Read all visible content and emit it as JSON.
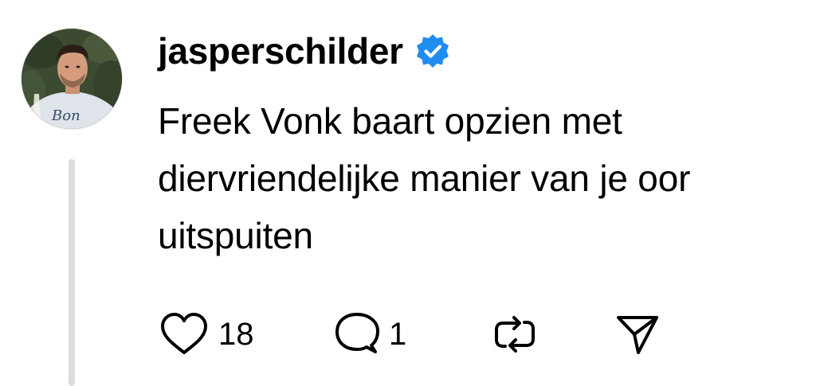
{
  "post": {
    "author": {
      "username": "jasperschilder",
      "verified": true,
      "avatar_text": "Bon"
    },
    "text": "Freek Vonk baart opzien met diervriendelijke manier van je oor uitspuiten",
    "actions": {
      "likes": "18",
      "replies": "1"
    }
  },
  "colors": {
    "verified_badge": "#1f8cf0",
    "thread_line": "#dcdcdc",
    "text": "#000000"
  },
  "icons": [
    "verified-badge-icon",
    "heart-icon",
    "comment-icon",
    "repost-icon",
    "share-icon"
  ]
}
